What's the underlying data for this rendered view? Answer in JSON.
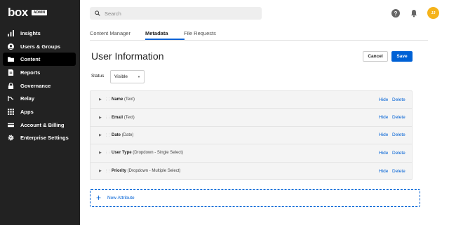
{
  "brand": {
    "logo": "box",
    "badge": "ADMIN"
  },
  "sidebar": {
    "items": [
      {
        "label": "Insights",
        "icon": "bar-chart-icon",
        "active": false
      },
      {
        "label": "Users & Groups",
        "icon": "user-icon",
        "active": false
      },
      {
        "label": "Content",
        "icon": "folder-icon",
        "active": true
      },
      {
        "label": "Reports",
        "icon": "document-icon",
        "active": false
      },
      {
        "label": "Governance",
        "icon": "lock-icon",
        "active": false
      },
      {
        "label": "Relay",
        "icon": "relay-icon",
        "active": false
      },
      {
        "label": "Apps",
        "icon": "grid-icon",
        "active": false
      },
      {
        "label": "Account & Billing",
        "icon": "card-icon",
        "active": false
      },
      {
        "label": "Enterprise Settings",
        "icon": "gear-icon",
        "active": false
      }
    ]
  },
  "search": {
    "placeholder": "Search"
  },
  "header": {
    "avatar_initials": "JJ"
  },
  "tabs": [
    {
      "label": "Content Manager",
      "active": false
    },
    {
      "label": "Metadata",
      "active": true
    },
    {
      "label": "File Requests",
      "active": false
    }
  ],
  "page": {
    "title": "User Information",
    "cancel_label": "Cancel",
    "save_label": "Save"
  },
  "status": {
    "label": "Status",
    "value": "Visible"
  },
  "attributes": [
    {
      "name": "Name",
      "type": "(Text)"
    },
    {
      "name": "Email",
      "type": "(Text)"
    },
    {
      "name": "Date",
      "type": "(Date)"
    },
    {
      "name": "User Type",
      "type": "(Dropdown - Single Select)"
    },
    {
      "name": "Priority",
      "type": "(Dropdown - Multiple Select)"
    }
  ],
  "attribute_actions": {
    "hide": "Hide",
    "delete": "Delete"
  },
  "new_attribute": {
    "label": "New Attribute"
  },
  "colors": {
    "accent": "#0061d5",
    "sidebar": "#222222",
    "avatar": "#f5b31b"
  }
}
